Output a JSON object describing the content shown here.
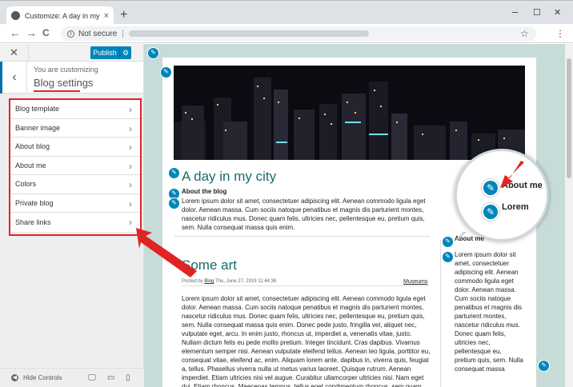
{
  "browser": {
    "tab_title": "Customize: A day in my city – Ju...",
    "tab_close": "×",
    "new_tab": "+",
    "minimize": "–",
    "maximize": "☐",
    "close": "✕",
    "back": "←",
    "forward": "→",
    "reload": "C",
    "not_secure": "Not secure",
    "star": "☆",
    "menu": "⋮"
  },
  "sidebar": {
    "close": "✕",
    "publish": "Publish",
    "back": "‹",
    "customizing_label": "You are customizing",
    "section_title": "Blog settings",
    "items": [
      {
        "label": "Blog template"
      },
      {
        "label": "Banner image"
      },
      {
        "label": "About blog"
      },
      {
        "label": "About me"
      },
      {
        "label": "Colors"
      },
      {
        "label": "Private blog"
      },
      {
        "label": "Share links"
      }
    ],
    "hide_controls": "Hide Controls"
  },
  "preview": {
    "blog_title": "A day in my city",
    "about_heading": "About the blog",
    "about_text": "Lorem ipsum dolor sit amet, consectetuer adipiscing elit. Aenean commodo ligula eget dolor. Aenean massa. Cum sociis natoque penatibus et magnis dis parturient montes, nascetur ridiculus mus. Donec quam felis, ultricies nec, pellentesque eu, pretium quis, sem. Nulla consequat massa quis enim.",
    "post_title": "Some art",
    "post_meta_prefix": "Posted by",
    "post_author": "Blog",
    "post_date": "Thu, June 27, 2019 11:44:38",
    "post_tag": "Museums",
    "post_text": "Lorem ipsum dolor sit amet, consectetuer adipiscing elit. Aenean commodo ligula eget dolor. Aenean massa. Cum sociis natoque penatibus et magnis dis parturient montes, nascetur ridiculus mus. Donec quam felis, ultricies nec, pellentesque eu, pretium quis, sem. Nulla consequat massa quis enim. Donec pede justo, fringilla vel, aliquet nec, vulputate eget, arcu. In enim justo, rhoncus ut, imperdiet a, venenatis vitae, justo. Nullam dictum felis eu pede mollis pretium. Integer tincidunt. Cras dapibus. Vivamus elementum semper nisi. Aenean vulputate eleifend tellus. Aenean leo ligula, porttitor eu, consequat vitae, eleifend ac, enim. Aliquam lorem ante, dapibus in, viverra quis, feugiat a, tellus. Phasellus viverra nulla ut metus varius laoreet. Quisque rutrum. Aenean imperdiet. Etiam ultricies nisi vel augue. Curabitur ullamcorper ultricies nisi. Nam eget dui. Etiam rhoncus. Maecenas tempus, tellus eget condimentum rhoncus, sem quam semper libero, sit amet adipiscing sem neque",
    "side_heading": "About me",
    "side_text": "Lorem ipsum dolor sit amet, consectetuer adipiscing elit. Aenean commodo ligula eget dolor. Aenean massa. Cum sociis natoque penatibus et magnis dis parturient montes, nascetur ridiculus mus. Donec quam felis, ultricies nec, pellentesque eu, pretium quis, sem. Nulla consequat massa",
    "magnifier_line1": "About me",
    "magnifier_line2": "Lorem"
  },
  "icons": {
    "pencil": "pencil-icon",
    "gear": "gear-icon"
  },
  "colors": {
    "accent": "#0085ba",
    "highlight": "#e02424",
    "title": "#1a6a6a",
    "preview_bg": "#c7dcd9"
  }
}
